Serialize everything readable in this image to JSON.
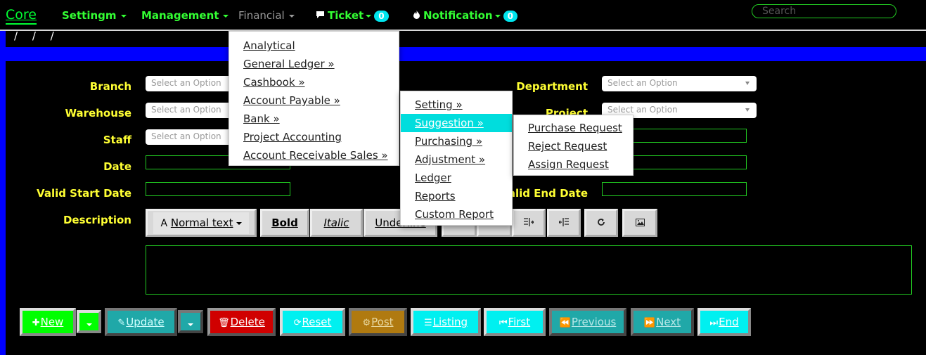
{
  "navbar": {
    "brand": "Core",
    "items": [
      {
        "label": "Settingm"
      },
      {
        "label": "Management"
      },
      {
        "label": "Financial"
      },
      {
        "label": "Ticket",
        "badge": "0"
      },
      {
        "label": "Notification",
        "badge": "0"
      }
    ],
    "search_placeholder": "Search"
  },
  "breadcrumb": "/ / /",
  "form": {
    "branch": {
      "label": "Branch",
      "placeholder": "Select an Option"
    },
    "warehouse": {
      "label": "Warehouse",
      "placeholder": "Select an Option"
    },
    "staff": {
      "label": "Staff",
      "placeholder": "Select an Option"
    },
    "date": {
      "label": "Date"
    },
    "valid_start_date": {
      "label": "Valid Start Date"
    },
    "description": {
      "label": "Description"
    },
    "department": {
      "label": "Department",
      "placeholder": "Select an Option"
    },
    "project": {
      "label": "Project",
      "placeholder": "Select an Option"
    },
    "valid_end_date": {
      "label": "Valid End Date"
    }
  },
  "editor": {
    "normal_text": "Normal text",
    "bold": "Bold",
    "italic": "Italic",
    "underline": "Underline"
  },
  "financial_menu": {
    "items": [
      "Analytical",
      "General Ledger »",
      "Cashbook »",
      "Account Payable »",
      "Bank »",
      "Project Accounting",
      "Account Receivable Sales »"
    ]
  },
  "submenu": {
    "items": [
      "Setting »",
      "Suggestion »",
      "Purchasing »",
      "Adjustment »",
      "Ledger",
      "Reports",
      "Custom Report"
    ]
  },
  "suggestion_menu": {
    "items": [
      "Purchase Request",
      "Reject Request",
      "Assign Request"
    ]
  },
  "actions": {
    "new": "New",
    "update": "Update",
    "delete": "Delete",
    "reset": "Reset",
    "post": "Post",
    "listing": "Listing",
    "first": "First",
    "previous": "Previous",
    "next": "Next",
    "end": "End"
  },
  "colors": {
    "nav_text": "#33ff33",
    "label": "#ffff33",
    "accent_cyan": "#00e5ee",
    "blue": "#0000ff"
  }
}
